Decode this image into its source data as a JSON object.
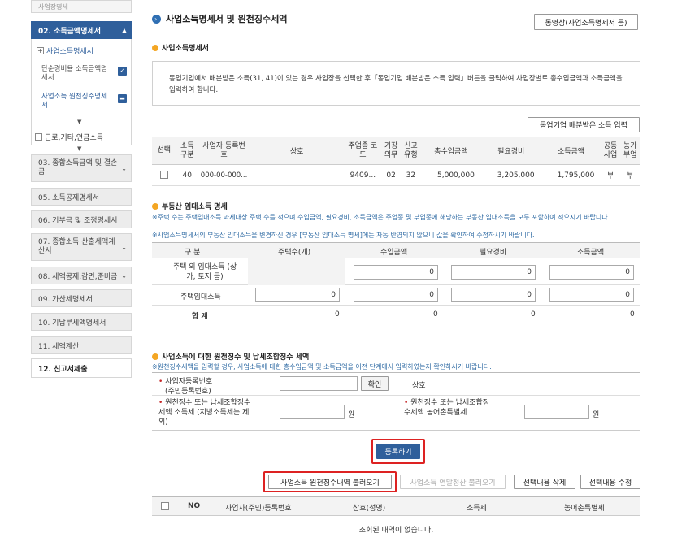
{
  "sidebar": {
    "top_cut": "사업장명세",
    "item02": "02. 소득금액명세서",
    "sub_business": "사업소득명세서",
    "sub_simple": "단순경비율 소득금액명세서",
    "sub_withhold": "사업소득 원천징수명세서",
    "sub_other": "근로,기타,연금소득",
    "item03": "03. 종합소득금액 및 결손금",
    "item05": "05. 소득공제명세서",
    "item06": "06. 기부금 및 조정명세서",
    "item07": "07. 종합소득 산출세액계산서",
    "item08": "08. 세액공제,감면,준비금",
    "item09": "09. 가산세명세서",
    "item10": "10. 기납부세액명세서",
    "item11": "11. 세액계산",
    "item12": "12. 신고서제출"
  },
  "header": {
    "title": "사업소득명세서 및 원천징수세액",
    "video_button": "동영상(사업소득명세서 등)"
  },
  "business": {
    "title": "사업소득명세서",
    "info": "동업기업에서 배분받은 소득(31, 41)이 있는 경우 사업장을 선택한 후「동업기업 배분받은 소득 입력」버튼을 클릭하여 사업장별로 총수입금액과 소득금액을 입력하여 합니다.",
    "partner_button": "동업기업 배분받은 소득 입력",
    "columns": [
      "선택",
      "소득 구분",
      "사업자 등록번호",
      "상호",
      "주업종 코드",
      "기장 의무",
      "신고 유형",
      "총수입금액",
      "필요경비",
      "소득금액",
      "공동 사업",
      "농가 부업"
    ],
    "rows": [
      {
        "income_type": "40",
        "reg_no": "000-00-000...",
        "name": "",
        "code": "9409...",
        "bookkeep": "02",
        "report": "32",
        "revenue": "5,000,000",
        "expense": "3,205,000",
        "income": "1,795,000",
        "joint": "부",
        "farm": "부"
      }
    ]
  },
  "rental": {
    "title": "부동산 임대소득 명세",
    "note1": "※주택 수는 주택임대소득 과세대상 주택 수를 적으며 수입금액, 필요경비, 소득금액은 주업종 및 부업종에 해당하는 부동산 임대소득을 모두 포함하여 적으시기 바랍니다.",
    "note2": "※사업소득명세서의 부동산 임대소득을 변경하신 경우 [부동산 임대소득 명세]에는 자동 반영되지 않으니 값을 확인하여 수정하시기 바랍니다.",
    "columns": [
      "구 분",
      "주택수(개)",
      "수입금액",
      "필요경비",
      "소득금액"
    ],
    "row1_label": "주택 외 임대소득 (상가, 토지 등)",
    "row2_label": "주택임대소득",
    "row3_label": "합 계",
    "row1": [
      "0",
      "0",
      "0"
    ],
    "row2": [
      "0",
      "0",
      "0",
      "0"
    ],
    "row3": [
      "0",
      "0",
      "0",
      "0"
    ]
  },
  "withholding": {
    "title": "사업소득에 대한 원천징수 및 납세조합징수 세액",
    "note": "※원천징수세액을 입력할 경우, 사업소득에 대한 총수입금액 및 소득금액을 이전 단계에서 입력하였는지 확인하시기 바랍니다.",
    "reg_label": "사업자등록번호",
    "reg_sub": "(주민등록번호)",
    "confirm_button": "확인",
    "name_label": "상호",
    "tax_label": "원천징수 또는 납세조합징수세액 소득세 (지방소득세는 제외)",
    "rural_label": "원천징수 또는 납세조합징수세액 농어촌특별세",
    "unit": "원",
    "register_button": "등록하기",
    "load_button": "사업소득 원천징수내역 불러오기",
    "load_yearend_button": "사업소득 연말정산 불러오기",
    "delete_button": "선택내용 삭제",
    "edit_button": "선택내용 수정",
    "columns": [
      "NO",
      "사업자(주민)등록번호",
      "상호(성명)",
      "소득세",
      "농어촌특별세"
    ],
    "empty": "조회된 내역이 없습니다."
  },
  "colors": {
    "accent": "#2f5f9b",
    "bullet": "#f4a623",
    "note": "#2e6aa3",
    "highlight": "#d22222"
  }
}
